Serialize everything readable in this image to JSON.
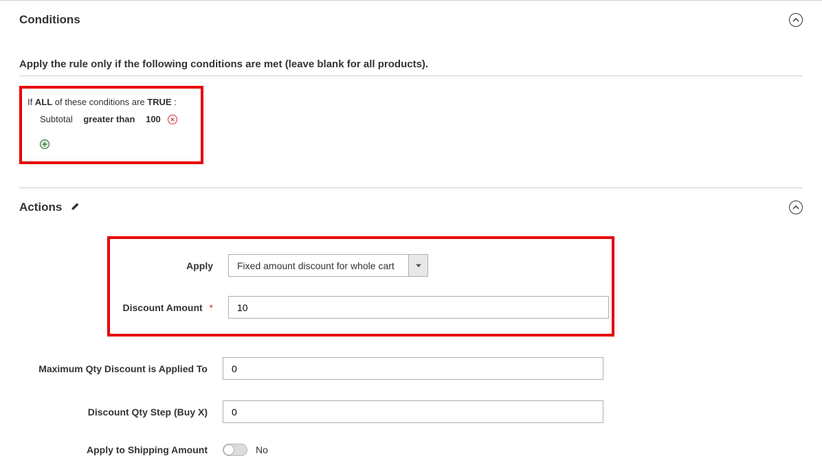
{
  "conditions": {
    "title": "Conditions",
    "subheading": "Apply the rule only if the following conditions are met (leave blank for all products).",
    "line1": {
      "if_text": "If",
      "all": "ALL",
      "middle": " of these conditions are ",
      "true": "TRUE",
      "colon": " :"
    },
    "line2": {
      "attr": "Subtotal",
      "op": "greater than",
      "val": "100"
    }
  },
  "actions": {
    "title": "Actions",
    "apply": {
      "label": "Apply",
      "value": "Fixed amount discount for whole cart"
    },
    "discount_amount": {
      "label": "Discount Amount",
      "value": "10"
    },
    "max_qty": {
      "label": "Maximum Qty Discount is Applied To",
      "value": "0"
    },
    "qty_step": {
      "label": "Discount Qty Step (Buy X)",
      "value": "0"
    },
    "apply_shipping": {
      "label": "Apply to Shipping Amount",
      "value": "No"
    }
  }
}
